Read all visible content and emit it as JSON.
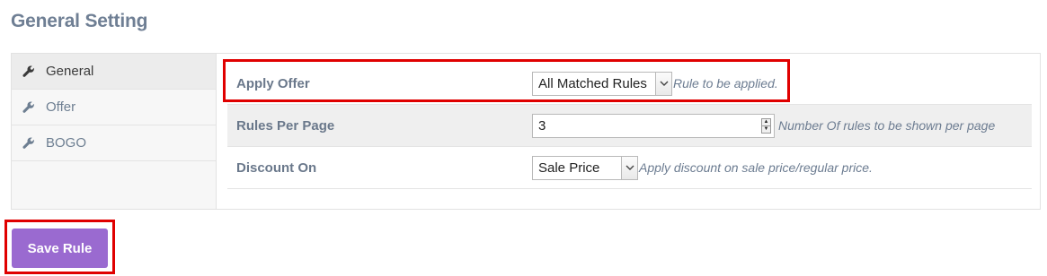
{
  "page": {
    "title": "General Setting"
  },
  "sidebar": {
    "items": [
      {
        "label": "General",
        "icon": "wrench-icon",
        "active": true
      },
      {
        "label": "Offer",
        "icon": "wrench-icon",
        "active": false
      },
      {
        "label": "BOGO",
        "icon": "wrench-icon",
        "active": false
      }
    ]
  },
  "settings": {
    "apply_offer": {
      "label": "Apply Offer",
      "value": "All Matched Rules",
      "hint": "Rule to be applied."
    },
    "rules_per_page": {
      "label": "Rules Per Page",
      "value": "3",
      "hint": "Number Of rules to be shown per page"
    },
    "discount_on": {
      "label": "Discount On",
      "value": "Sale Price",
      "hint": "Apply discount on sale price/regular price."
    }
  },
  "actions": {
    "save_label": "Save Rule"
  },
  "colors": {
    "accent": "#9a6ad0",
    "highlight": "#e00000",
    "title": "#6f7f94"
  }
}
